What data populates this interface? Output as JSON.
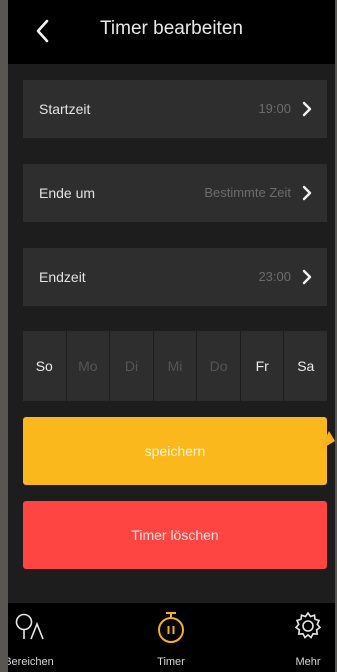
{
  "header": {
    "title": "Timer bearbeiten",
    "back_icon": "chevron-left-icon"
  },
  "rows": [
    {
      "label": "Startzeit",
      "value": "19:00"
    },
    {
      "label": "Ende um",
      "value": "Bestimmte Zeit"
    },
    {
      "label": "Endzeit",
      "value": "23:00"
    }
  ],
  "days": [
    {
      "label": "So",
      "active": true
    },
    {
      "label": "Mo",
      "active": false
    },
    {
      "label": "Di",
      "active": false
    },
    {
      "label": "Mi",
      "active": false
    },
    {
      "label": "Do",
      "active": false
    },
    {
      "label": "Fr",
      "active": true
    },
    {
      "label": "Sa",
      "active": true
    }
  ],
  "buttons": {
    "save_label": "speichern",
    "delete_label": "Timer löschen"
  },
  "tabbar": {
    "items": [
      {
        "label": "Bereichen",
        "icon": "area-icon",
        "active": false
      },
      {
        "label": "Timer",
        "icon": "timer-icon",
        "active": true
      },
      {
        "label": "Mehr",
        "icon": "gear-icon",
        "active": false
      }
    ]
  },
  "colors": {
    "save": "#fbb81c",
    "delete": "#fe4541",
    "accent": "#f5b21e"
  }
}
